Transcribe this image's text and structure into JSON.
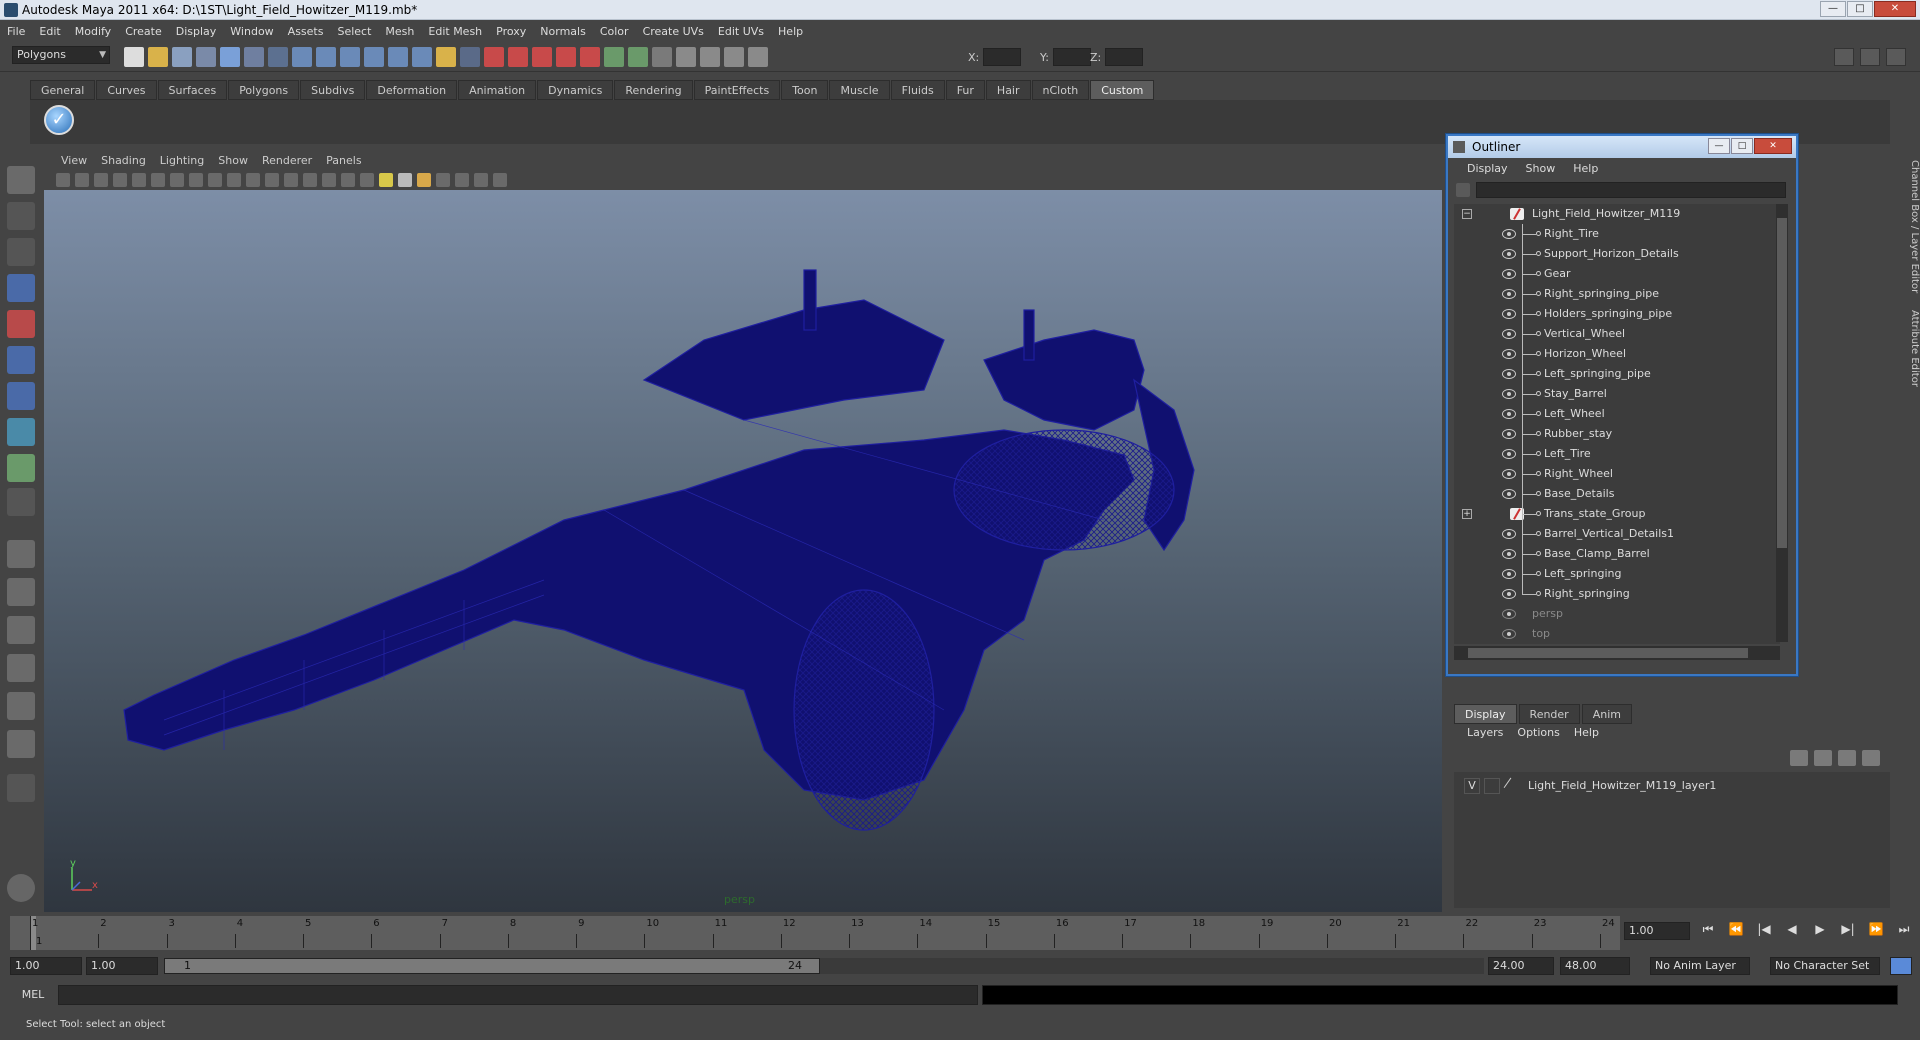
{
  "window": {
    "title": "Autodesk Maya 2011 x64: D:\\1ST\\Light_Field_Howitzer_M119.mb*"
  },
  "menubar": [
    "File",
    "Edit",
    "Modify",
    "Create",
    "Display",
    "Window",
    "Assets",
    "Select",
    "Mesh",
    "Edit Mesh",
    "Proxy",
    "Normals",
    "Color",
    "Create UVs",
    "Edit UVs",
    "Help"
  ],
  "toolbar": {
    "mode": "Polygons",
    "x_label": "X:",
    "y_label": "Y:",
    "z_label": "Z:"
  },
  "shelf_tabs": [
    "General",
    "Curves",
    "Surfaces",
    "Polygons",
    "Subdivs",
    "Deformation",
    "Animation",
    "Dynamics",
    "Rendering",
    "PaintEffects",
    "Toon",
    "Muscle",
    "Fluids",
    "Fur",
    "Hair",
    "nCloth",
    "Custom"
  ],
  "shelf_active": "Custom",
  "viewport": {
    "menu": [
      "View",
      "Shading",
      "Lighting",
      "Show",
      "Renderer",
      "Panels"
    ],
    "camera_label": "persp",
    "axis_y": "y",
    "axis_x": "x"
  },
  "outliner": {
    "title": "Outliner",
    "menu": [
      "Display",
      "Show",
      "Help"
    ],
    "root": "Light_Field_Howitzer_M119",
    "items": [
      "Right_Tire",
      "Support_Horizon_Details",
      "Gear",
      "Right_springing_pipe",
      "Holders_springing_pipe",
      "Vertical_Wheel",
      "Horizon_Wheel",
      "Left_springing_pipe",
      "Stay_Barrel",
      "Left_Wheel",
      "Rubber_stay",
      "Left_Tire",
      "Right_Wheel",
      "Base_Details",
      "Trans_state_Group",
      "Barrel_Vertical_Details1",
      "Base_Clamp_Barrel",
      "Left_springing",
      "Right_springing"
    ],
    "cameras": [
      "persp",
      "top"
    ]
  },
  "channel_tabs": {
    "channel_box": "Channel Box / Layer Editor",
    "attribute_editor": "Attribute Editor"
  },
  "layer_editor": {
    "tabs": [
      "Display",
      "Render",
      "Anim"
    ],
    "menu": [
      "Layers",
      "Options",
      "Help"
    ],
    "layer_visible": "V",
    "layer_name": "Light_Field_Howitzer_M119_layer1"
  },
  "timeline": {
    "ticks": [
      "1",
      "2",
      "3",
      "4",
      "5",
      "6",
      "7",
      "8",
      "9",
      "10",
      "11",
      "12",
      "13",
      "14",
      "15",
      "16",
      "17",
      "18",
      "19",
      "20",
      "21",
      "22",
      "23",
      "24"
    ],
    "current_frame": "1.00",
    "current_marker": "1"
  },
  "range": {
    "start": "1.00",
    "anim_start": "1.00",
    "slider_start": "1",
    "slider_end": "24",
    "end": "24.00",
    "anim_end": "48.00",
    "anim_layer": "No Anim Layer",
    "character_set": "No Character Set"
  },
  "cmdline": {
    "lang": "MEL"
  },
  "helpline": {
    "text": "Select Tool: select an object"
  }
}
